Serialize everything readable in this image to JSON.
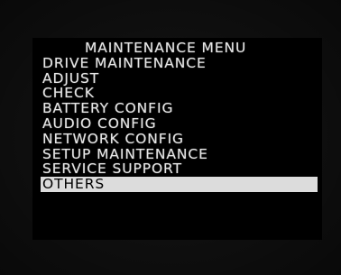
{
  "menu": {
    "title": "MAINTENANCE MENU",
    "items": [
      {
        "label": "DRIVE MAINTENANCE"
      },
      {
        "label": "ADJUST"
      },
      {
        "label": "CHECK"
      },
      {
        "label": "BATTERY CONFIG"
      },
      {
        "label": "AUDIO CONFIG"
      },
      {
        "label": "NETWORK CONFIG"
      },
      {
        "label": "SETUP MAINTENANCE"
      },
      {
        "label": "SERVICE SUPPORT"
      },
      {
        "label": "OTHERS"
      }
    ],
    "selected_index": 8
  },
  "colors": {
    "background": "#0e0e0e",
    "menu_background": "#000000",
    "text": "#e6e6e6",
    "highlight": "#dcdcdc",
    "highlight_text": "#000000"
  }
}
